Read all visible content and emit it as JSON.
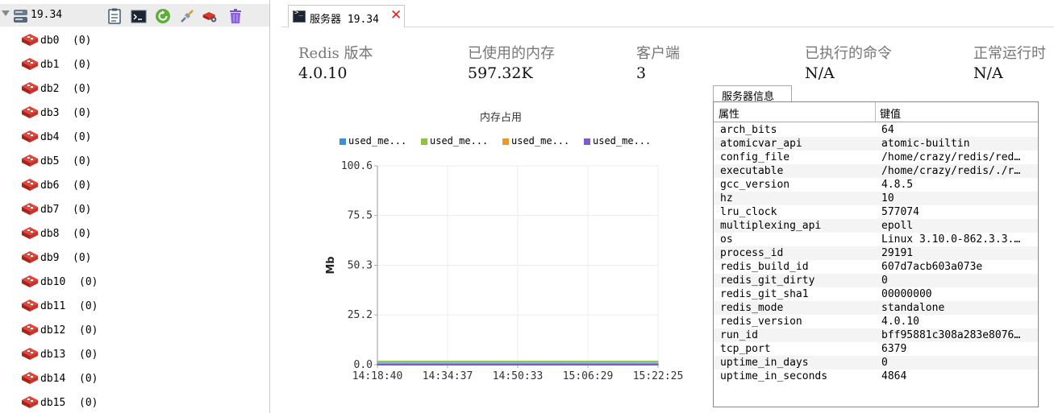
{
  "sidebar": {
    "server_name": "19.34",
    "toolbar_icons": [
      "info-icon",
      "console-icon",
      "refresh-icon",
      "connect-icon",
      "settings-icon",
      "trash-icon"
    ],
    "databases": [
      {
        "name": "db0",
        "count": "(0)"
      },
      {
        "name": "db1",
        "count": "(0)"
      },
      {
        "name": "db2",
        "count": "(0)"
      },
      {
        "name": "db3",
        "count": "(0)"
      },
      {
        "name": "db4",
        "count": "(0)"
      },
      {
        "name": "db5",
        "count": "(0)"
      },
      {
        "name": "db6",
        "count": "(0)"
      },
      {
        "name": "db7",
        "count": "(0)"
      },
      {
        "name": "db8",
        "count": "(0)"
      },
      {
        "name": "db9",
        "count": "(0)"
      },
      {
        "name": "db10",
        "count": "(0)"
      },
      {
        "name": "db11",
        "count": "(0)"
      },
      {
        "name": "db12",
        "count": "(0)"
      },
      {
        "name": "db13",
        "count": "(0)"
      },
      {
        "name": "db14",
        "count": "(0)"
      },
      {
        "name": "db15",
        "count": "(0)"
      }
    ]
  },
  "tab": {
    "label": "服务器 19.34",
    "close": "✕"
  },
  "stats": [
    {
      "label": "Redis 版本",
      "value": "4.0.10"
    },
    {
      "label": "已使用的内存",
      "value": "597.32K"
    },
    {
      "label": "客户端",
      "value": "3"
    },
    {
      "label": "已执行的命令",
      "value": "N/A"
    },
    {
      "label": "正常运行时",
      "value": "N/A"
    }
  ],
  "chart_data": {
    "type": "line",
    "title": "内存占用",
    "ylabel": "Mb",
    "xlabel": "",
    "x": [
      "14:18:40",
      "14:34:37",
      "14:50:33",
      "15:06:29",
      "15:22:25"
    ],
    "y_ticks": [
      "0.0",
      "25.2",
      "50.3",
      "75.5",
      "100.6"
    ],
    "ylim": [
      0,
      100.6
    ],
    "grid": true,
    "legend_position": "top",
    "series": [
      {
        "name": "used_me...",
        "color": "#3a8fd4",
        "values": [
          0.6,
          0.6,
          0.6,
          0.6,
          0.6
        ]
      },
      {
        "name": "used_me...",
        "color": "#8cc43c",
        "values": [
          1.6,
          1.6,
          1.6,
          1.6,
          1.6
        ]
      },
      {
        "name": "used_me...",
        "color": "#e89a2a",
        "values": [
          0.3,
          0.3,
          0.3,
          0.3,
          0.3
        ]
      },
      {
        "name": "used_me...",
        "color": "#7a5ccc",
        "values": [
          0.0,
          0.0,
          0.0,
          0.0,
          0.0
        ]
      }
    ]
  },
  "info": {
    "tab_label": "服务器信息",
    "col_key": "属性",
    "col_value": "键值",
    "rows": [
      {
        "k": "arch_bits",
        "v": "64"
      },
      {
        "k": "atomicvar_api",
        "v": "atomic-builtin"
      },
      {
        "k": "config_file",
        "v": "/home/crazy/redis/red…"
      },
      {
        "k": "executable",
        "v": "/home/crazy/redis/./r…"
      },
      {
        "k": "gcc_version",
        "v": "4.8.5"
      },
      {
        "k": "hz",
        "v": "10"
      },
      {
        "k": "lru_clock",
        "v": "577074"
      },
      {
        "k": "multiplexing_api",
        "v": "epoll"
      },
      {
        "k": "os",
        "v": "Linux 3.10.0-862.3.3.…"
      },
      {
        "k": "process_id",
        "v": "29191"
      },
      {
        "k": "redis_build_id",
        "v": "607d7acb603a073e"
      },
      {
        "k": "redis_git_dirty",
        "v": "0"
      },
      {
        "k": "redis_git_sha1",
        "v": "00000000"
      },
      {
        "k": "redis_mode",
        "v": "standalone"
      },
      {
        "k": "redis_version",
        "v": "4.0.10"
      },
      {
        "k": "run_id",
        "v": "bff95881c308a283e8076…"
      },
      {
        "k": "tcp_port",
        "v": "6379"
      },
      {
        "k": "uptime_in_days",
        "v": "0"
      },
      {
        "k": "uptime_in_seconds",
        "v": "4864"
      }
    ]
  }
}
